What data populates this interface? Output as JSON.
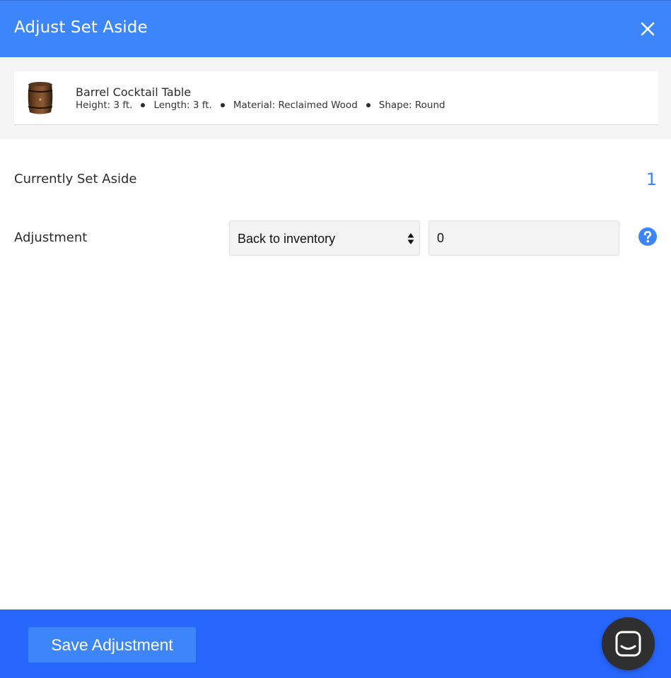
{
  "dialog": {
    "title": "Adjust Set Aside",
    "close_icon": "close-icon"
  },
  "item": {
    "name": "Barrel Cocktail Table",
    "thumbnail": "barrel-image",
    "specs": [
      "Height: 3 ft.",
      "Length: 3 ft.",
      "Material: Reclaimed Wood",
      "Shape: Round"
    ]
  },
  "set_aside": {
    "label": "Currently Set Aside",
    "value": "1"
  },
  "adjustment": {
    "label": "Adjustment",
    "selected_option": "Back to inventory",
    "quantity_value": "0",
    "help_icon": "help-icon"
  },
  "footer": {
    "save_label": "Save Adjustment",
    "chat_icon": "chat-icon"
  },
  "colors": {
    "header_bg": "#3d85fb",
    "footer_bg": "#2766fb",
    "accent": "#3d85fb",
    "chat_launcher": "#2f2f2f"
  }
}
